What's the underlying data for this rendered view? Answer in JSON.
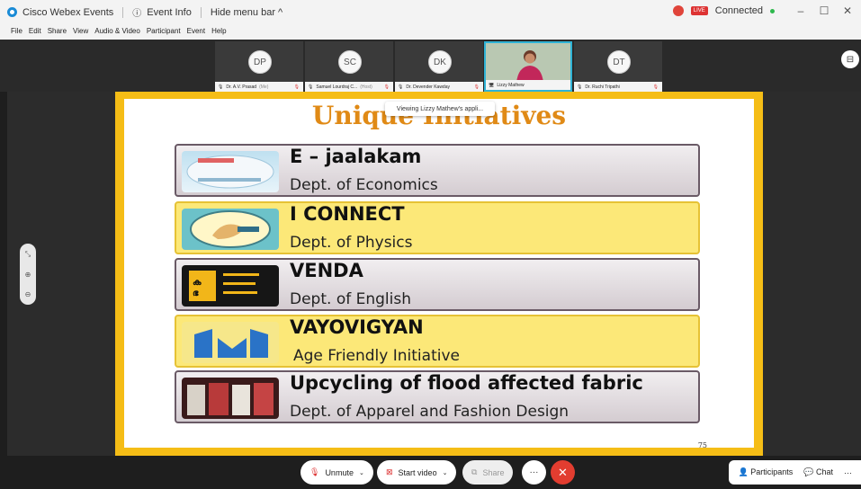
{
  "titlebar": {
    "app_name": "Cisco Webex Events",
    "event_info": "Event Info",
    "hide_menu": "Hide menu bar ^",
    "status": "Connected",
    "live_badge": "LIVE"
  },
  "menu": [
    "File",
    "Edit",
    "Share",
    "View",
    "Audio & Video",
    "Participant",
    "Event",
    "Help"
  ],
  "participants": [
    {
      "initials": "DP",
      "name": "Dr. A.V. Prasad",
      "tag": "(Me)"
    },
    {
      "initials": "SC",
      "name": "Samuel Lourdraj C...",
      "tag": "(Host)"
    },
    {
      "initials": "DK",
      "name": "Dr. Devender Kawday",
      "tag": ""
    },
    {
      "initials": "",
      "name": "Lizzy Mathew",
      "tag": ""
    },
    {
      "initials": "DT",
      "name": "Dr. Ruchi Tripathi",
      "tag": ""
    }
  ],
  "viewing_tooltip": "Viewing Lizzy Mathew's appli...",
  "slide": {
    "title": "Unique Initiatives",
    "page": "75",
    "rows": [
      {
        "title": "E – jaalakam",
        "subtitle": "Dept. of Economics",
        "style": "grey",
        "img_caption": "e-jaalakam"
      },
      {
        "title": "I CONNECT",
        "subtitle": "Dept. of Physics",
        "style": "yellow",
        "img_caption": "I CONNECT"
      },
      {
        "title": "VENDA",
        "subtitle": "Dept. of English",
        "style": "grey",
        "img_caption": "VENDA"
      },
      {
        "title": "VAYOVIGYAN",
        "subtitle": "Age Friendly Initiative",
        "style": "yellow",
        "img_caption": "VAYOVIGYAN"
      },
      {
        "title": "Upcycling of flood affected fabric",
        "subtitle": "Dept. of Apparel and Fashion Design",
        "style": "grey",
        "img_caption": "fabric"
      }
    ]
  },
  "controls": {
    "unmute": "Unmute",
    "start_video": "Start video",
    "share": "Share",
    "more": "···",
    "participants": "Participants",
    "chat": "Chat",
    "panel_more": "···"
  }
}
